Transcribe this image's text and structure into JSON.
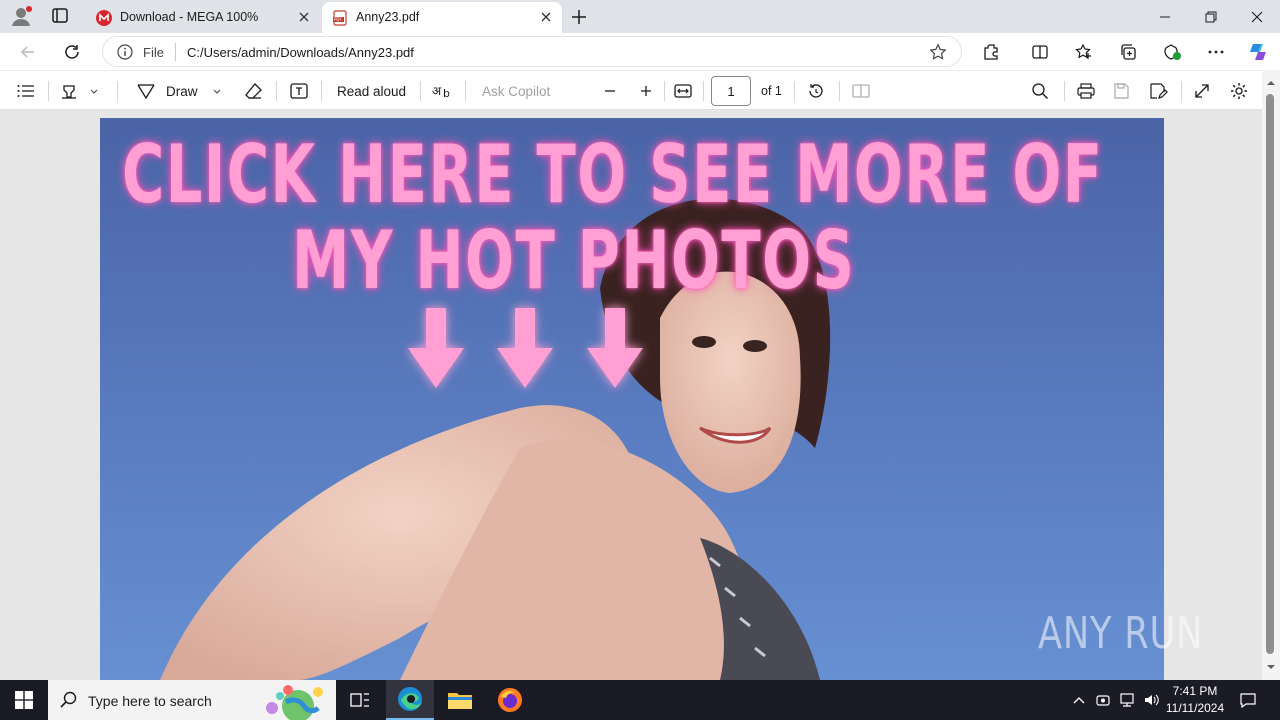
{
  "browser": {
    "tabs": [
      {
        "title": "Download - MEGA 100%",
        "icon": "mega-icon",
        "active": false
      },
      {
        "title": "Anny23.pdf",
        "icon": "pdf-icon",
        "active": true
      }
    ],
    "address": {
      "scheme_label": "File",
      "url": "C:/Users/admin/Downloads/Anny23.pdf"
    }
  },
  "pdf_toolbar": {
    "draw_label": "Draw",
    "read_aloud_label": "Read aloud",
    "ask_copilot_label": "Ask Copilot",
    "page_number": "1",
    "page_total": "of 1"
  },
  "document": {
    "headline_line1": "CLICK HERE TO SEE MORE OF",
    "headline_line2": "MY HOT PHOTOS",
    "arrow_count": 3
  },
  "watermark": "ANY RUN",
  "taskbar": {
    "search_placeholder": "Type here to search",
    "time": "7:41 PM",
    "date": "11/11/2024"
  },
  "colors": {
    "accent": "#0a5fc4",
    "promo_pink": "#ff9fd4",
    "page_blue": "#5a7cc0",
    "mega_red": "#d9272e"
  }
}
